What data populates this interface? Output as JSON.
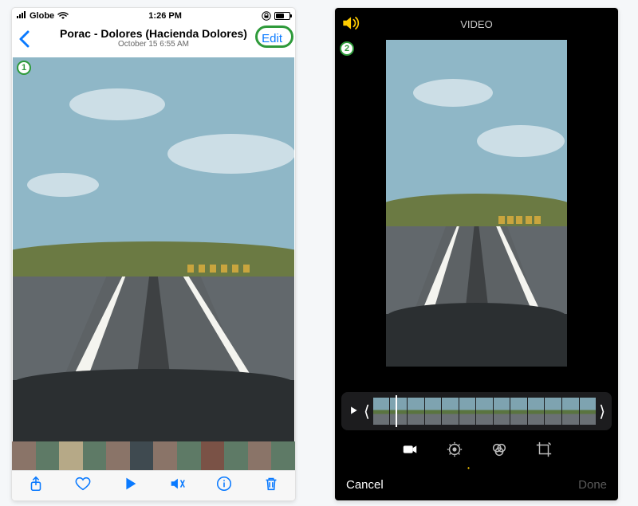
{
  "left": {
    "status": {
      "carrier": "Globe",
      "time": "1:26 PM"
    },
    "nav": {
      "title": "Porac - Dolores (Hacienda Dolores)",
      "subtitle": "October 15  6:55 AM",
      "edit_label": "Edit"
    },
    "badge": "1",
    "toolbar_icons": [
      "share",
      "favorite",
      "play",
      "mute",
      "info",
      "trash"
    ],
    "thumbnail_count": 12
  },
  "right": {
    "header": "VIDEO",
    "badge": "2",
    "timeline_frame_count": 13,
    "tools": [
      "video",
      "adjust",
      "filters",
      "crop"
    ],
    "actions": {
      "cancel": "Cancel",
      "done": "Done"
    }
  }
}
